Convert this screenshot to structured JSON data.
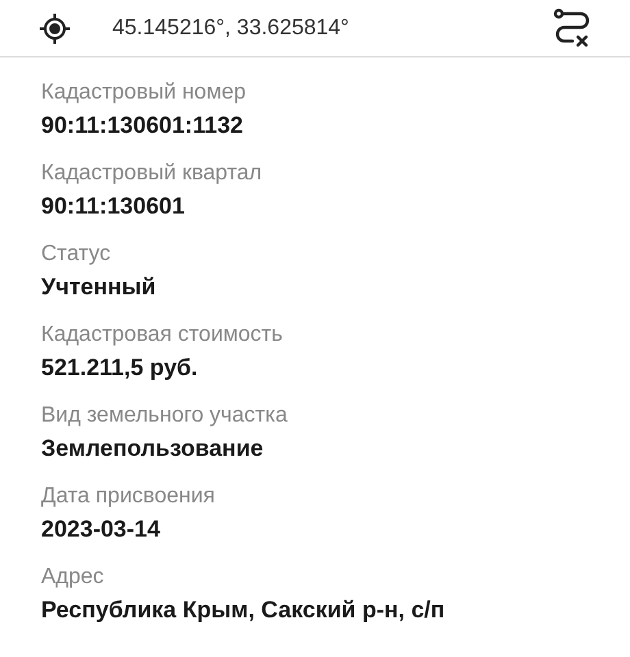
{
  "location": {
    "coordinates": "45.145216°, 33.625814°"
  },
  "fields": [
    {
      "label": "Кадастровый номер",
      "value": "90:11:130601:1132"
    },
    {
      "label": "Кадастровый квартал",
      "value": "90:11:130601"
    },
    {
      "label": "Статус",
      "value": "Учтенный"
    },
    {
      "label": "Кадастровая стоимость",
      "value": "521.211,5 руб."
    },
    {
      "label": "Вид земельного участка",
      "value": "Землепользование"
    },
    {
      "label": "Дата присвоения",
      "value": "2023-03-14"
    },
    {
      "label": "Адрес",
      "value": "Республика Крым, Сакский р-н, с/п"
    }
  ]
}
